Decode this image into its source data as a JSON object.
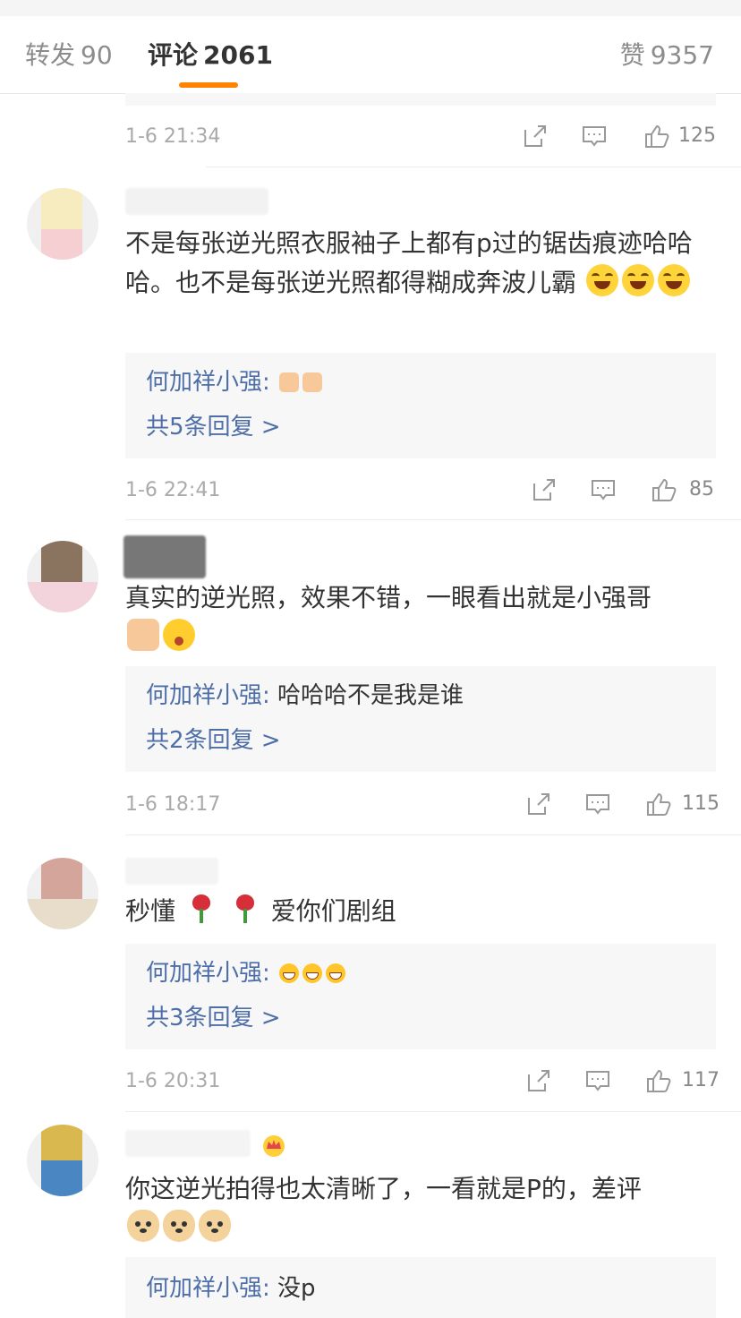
{
  "tabs": {
    "repost": {
      "label": "转发",
      "count": "90"
    },
    "comments": {
      "label": "评论",
      "count": "2061"
    },
    "likes": {
      "label": "赞",
      "count": "9357"
    }
  },
  "colors": {
    "accent": "#ff8200",
    "link": "#4e6ea8",
    "reply_bg": "#f7f7f7"
  },
  "previous_comment": {
    "time": "1-6 21:34",
    "like_count": "125"
  },
  "comments": [
    {
      "text": "不是每张逆光照衣服袖子上都有p过的锯齿痕迹哈哈哈。也不是每张逆光照都得糊成奔波儿霸",
      "emojis": [
        "laugh-cry-emoji",
        "laugh-cry-emoji",
        "laugh-cry-emoji"
      ],
      "reply": {
        "author": "何加祥小强:",
        "text": "",
        "emojis": [
          "thumbs-up-emoji",
          "thumbs-up-emoji"
        ]
      },
      "more_replies": "共5条回复 >",
      "time": "1-6 22:41",
      "like_count": "85"
    },
    {
      "text": "真实的逆光照，效果不错，一眼看出就是小强哥",
      "emojis": [
        "thumbs-up-emoji",
        "shocked-emoji"
      ],
      "reply": {
        "author": "何加祥小强:",
        "text": "哈哈哈不是我是谁",
        "emojis": []
      },
      "more_replies": "共2条回复 >",
      "time": "1-6 18:17",
      "like_count": "115"
    },
    {
      "text_before": "秒懂",
      "text_after": "爱你们剧组",
      "emojis": [
        "rose-emoji",
        "rose-emoji"
      ],
      "reply": {
        "author": "何加祥小强:",
        "text": "",
        "emojis": [
          "grin-emoji",
          "grin-emoji",
          "grin-emoji"
        ]
      },
      "more_replies": "共3条回复 >",
      "time": "1-6 20:31",
      "like_count": "117"
    },
    {
      "text": "你这逆光拍得也太清晰了，一看就是P的，差评",
      "emojis": [
        "doge-emoji",
        "doge-emoji",
        "doge-emoji"
      ],
      "reply": {
        "author": "何加祥小强:",
        "text": "没p",
        "emojis": []
      }
    }
  ]
}
